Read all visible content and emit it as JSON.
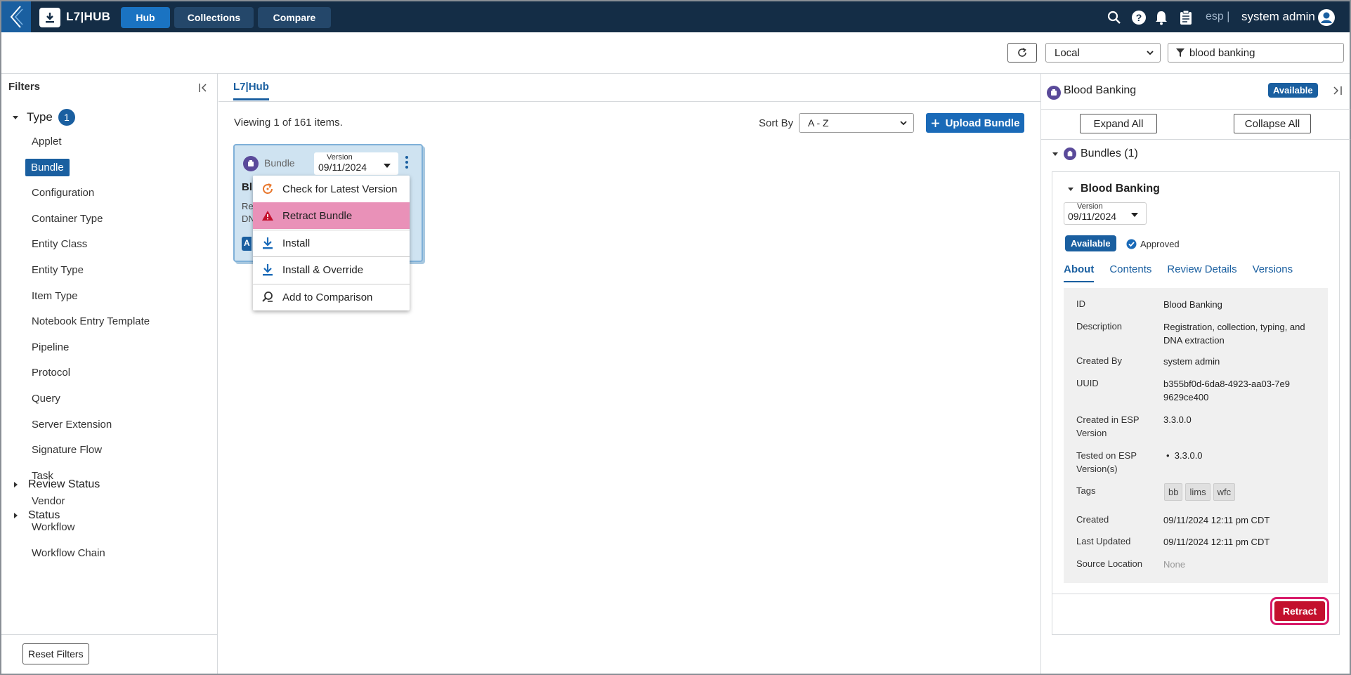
{
  "app": {
    "title": "L7|HUB",
    "tenant": "esp |",
    "user": "system admin"
  },
  "nav": {
    "hub": "Hub",
    "collections": "Collections",
    "compare": "Compare"
  },
  "toolbar": {
    "scope": "Local",
    "search_value": "blood banking"
  },
  "filters": {
    "heading": "Filters",
    "type_label": "Type",
    "type_count": "1",
    "items": [
      "Applet",
      "Bundle",
      "Configuration",
      "Container Type",
      "Entity Class",
      "Entity Type",
      "Item Type",
      "Notebook Entry Template",
      "Pipeline",
      "Protocol",
      "Query",
      "Server Extension",
      "Signature Flow",
      "Task",
      "Vendor",
      "Workflow",
      "Workflow Chain"
    ],
    "selected": "Bundle",
    "review_status": "Review Status",
    "status": "Status",
    "reset": "Reset Filters"
  },
  "main": {
    "tab": "L7|Hub",
    "viewing": "Viewing 1 of 161 items.",
    "sort_label": "Sort By",
    "sort_value": "A - Z",
    "upload": "Upload Bundle"
  },
  "card": {
    "type": "Bundle",
    "version_label": "Version",
    "version": "09/11/2024",
    "title": "Bl",
    "desc1": "Re",
    "desc2": "DN",
    "badge": "A"
  },
  "menu": {
    "items": [
      "Check for Latest Version",
      "Retract Bundle",
      "Install",
      "Install & Override",
      "Add to Comparison"
    ]
  },
  "panel": {
    "title": "Blood Banking",
    "status": "Available",
    "expand": "Expand All",
    "collapse": "Collapse All",
    "bundles": "Bundles (1)",
    "bundle_title": "Blood Banking",
    "version_label": "Version",
    "version": "09/11/2024",
    "badge": "Available",
    "approved": "Approved",
    "tabs": [
      "About",
      "Contents",
      "Review Details",
      "Versions"
    ],
    "details": {
      "id_label": "ID",
      "id": "Blood Banking",
      "desc_label": "Description",
      "desc": "Registration, collection, typing, and DNA extraction",
      "created_by_label": "Created By",
      "created_by": "system admin",
      "uuid_label": "UUID",
      "uuid": "b355bf0d-6da8-4923-aa03-7e99629ce400",
      "created_in_label1": "Created in ESP",
      "created_in_label2": "Version",
      "created_in": "3.3.0.0",
      "tested_label1": "Tested on ESP",
      "tested_label2": "Version(s)",
      "tested": "3.3.0.0",
      "tags_label": "Tags",
      "tags": [
        "bb",
        "lims",
        "wfc"
      ],
      "created_label": "Created",
      "created": "09/11/2024 12:11 pm CDT",
      "updated_label": "Last Updated",
      "updated": "09/11/2024 12:11 pm CDT",
      "source_label": "Source Location",
      "source": "None"
    },
    "retract": "Retract"
  },
  "colors": {
    "nav_bg": "#142d46",
    "accent": "#1a5fa0",
    "danger": "#c3102d",
    "menu_highlight": "#e991b8"
  }
}
